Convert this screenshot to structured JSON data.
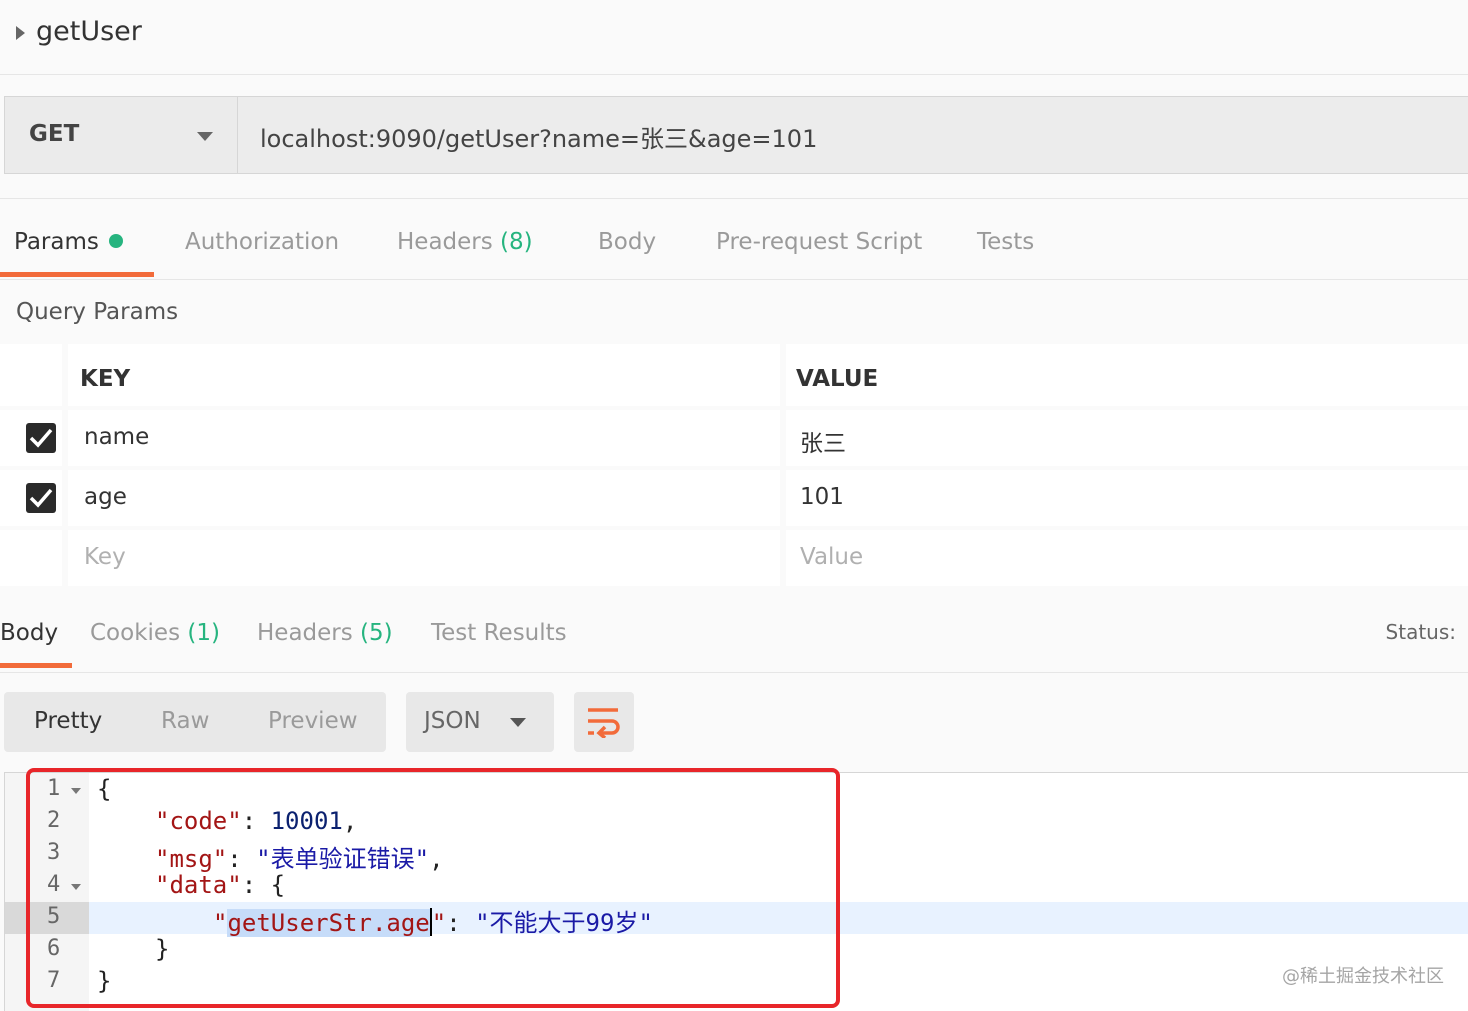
{
  "request": {
    "name": "getUser"
  },
  "url_bar": {
    "method": "GET",
    "url": "localhost:9090/getUser?name=张三&age=101"
  },
  "request_tabs": [
    {
      "label": "Params",
      "active": true
    },
    {
      "label": "Authorization"
    },
    {
      "label": "Headers",
      "count": "(8)"
    },
    {
      "label": "Body"
    },
    {
      "label": "Pre-request Script"
    },
    {
      "label": "Tests"
    }
  ],
  "query_params": {
    "title": "Query Params",
    "headers": {
      "key": "KEY",
      "value": "VALUE"
    },
    "rows": [
      {
        "key": "name",
        "value": "张三",
        "checked": true
      },
      {
        "key": "age",
        "value": "101",
        "checked": true
      }
    ],
    "placeholder": {
      "key": "Key",
      "value": "Value"
    }
  },
  "response_tabs": [
    {
      "label": "Body",
      "active": true
    },
    {
      "label": "Cookies",
      "count": "(1)"
    },
    {
      "label": "Headers",
      "count": "(5)"
    },
    {
      "label": "Test Results"
    }
  ],
  "status_label": "Status:",
  "format_options": [
    "Pretty",
    "Raw",
    "Preview"
  ],
  "language": "JSON",
  "editor": {
    "line_numbers": [
      "1",
      "2",
      "3",
      "4",
      "5",
      "6",
      "7"
    ],
    "code": {
      "l1": "{",
      "l2_key": "\"code\"",
      "l2_colon": ": ",
      "l2_val": "10001",
      "l2_end": ",",
      "l3_key": "\"msg\"",
      "l3_colon": ": ",
      "l3_val": "\"表单验证错误\"",
      "l3_end": ",",
      "l4_key": "\"data\"",
      "l4_rest": ": {",
      "l5_q": "\"",
      "l5_sel": "getUserStr.age",
      "l5_q2": "\"",
      "l5_colon": ": ",
      "l5_val": "\"不能大于99岁\"",
      "l6": "}",
      "l7": "}"
    },
    "highlighted_line": 5
  },
  "watermark": "@稀土掘金技术社区",
  "colors": {
    "accent": "#f26b3a",
    "count_green": "#26b47f",
    "highlight_box": "#e8262a"
  }
}
